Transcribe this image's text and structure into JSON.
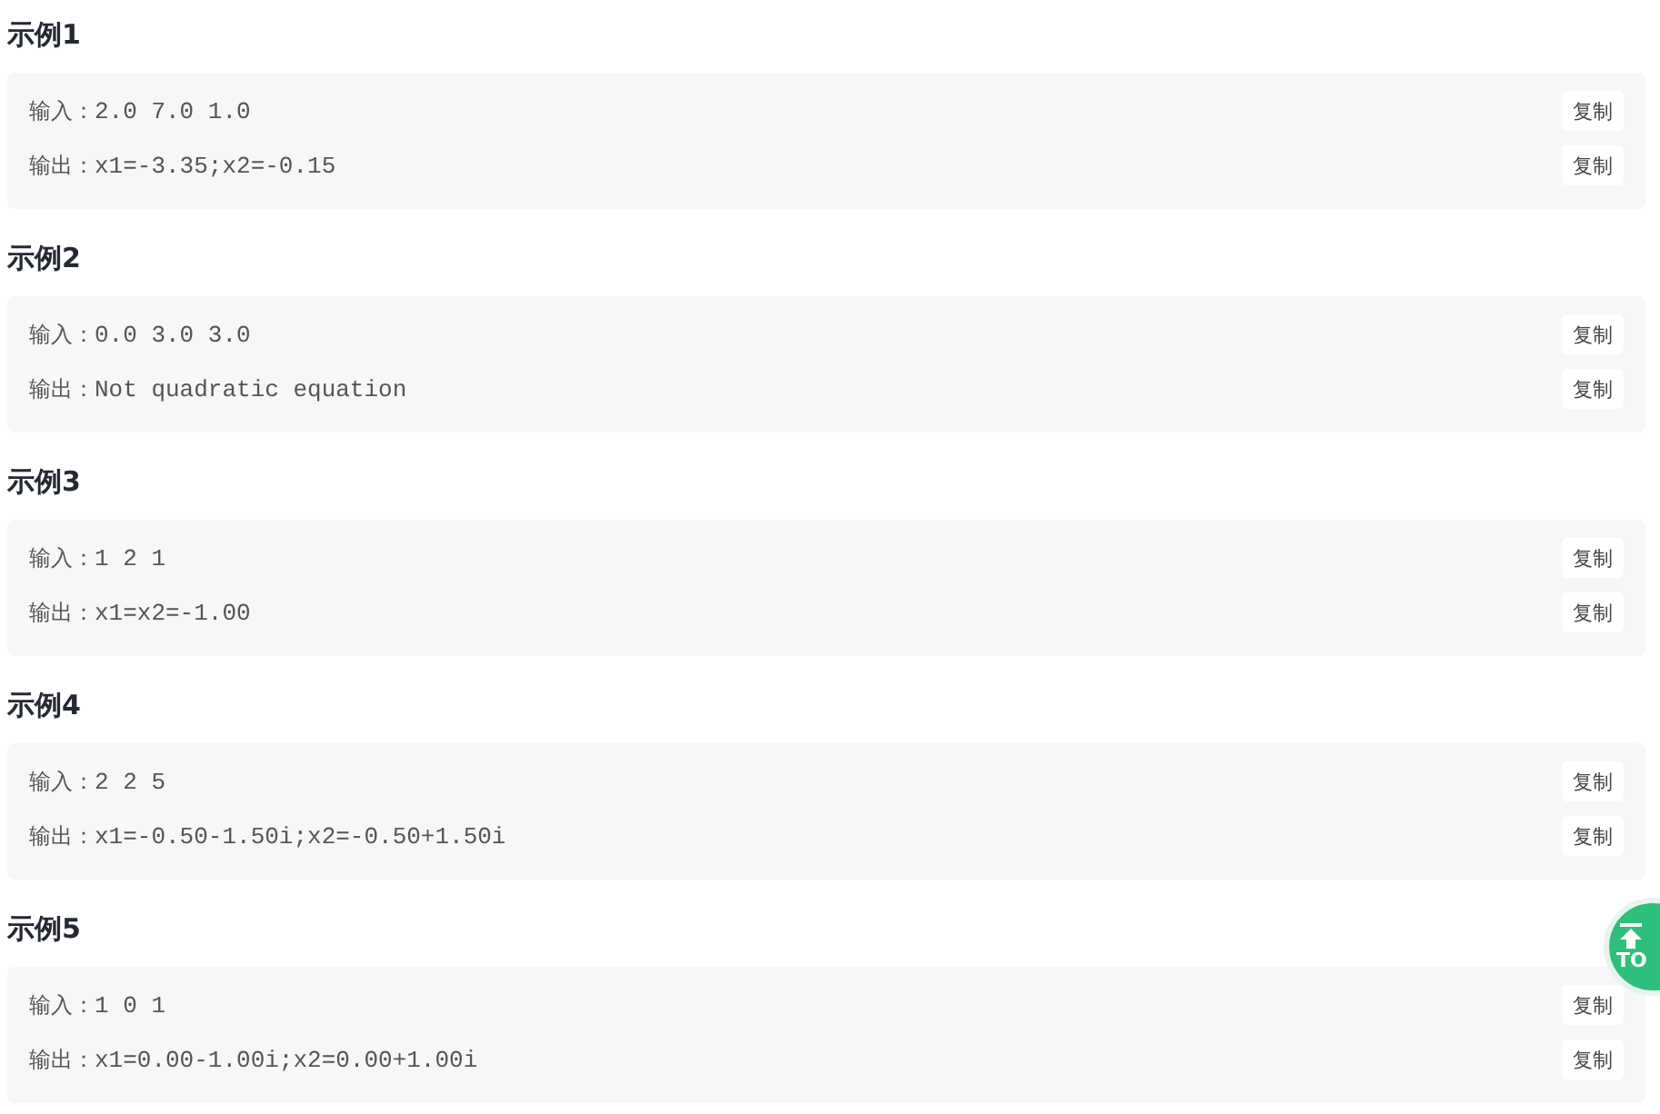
{
  "examples": [
    {
      "title": "示例1",
      "lines": [
        {
          "label": "输入：",
          "value": "2.0 7.0 1.0",
          "button": "复制"
        },
        {
          "label": "输出：",
          "value": "x1=-3.35;x2=-0.15",
          "button": "复制"
        }
      ]
    },
    {
      "title": "示例2",
      "lines": [
        {
          "label": "输入：",
          "value": "0.0 3.0 3.0",
          "button": "复制"
        },
        {
          "label": "输出：",
          "value": "Not quadratic equation",
          "button": "复制"
        }
      ]
    },
    {
      "title": "示例3",
      "lines": [
        {
          "label": "输入：",
          "value": "1 2 1",
          "button": "复制"
        },
        {
          "label": "输出：",
          "value": "x1=x2=-1.00",
          "button": "复制"
        }
      ]
    },
    {
      "title": "示例4",
      "lines": [
        {
          "label": "输入：",
          "value": "2 2 5",
          "button": "复制"
        },
        {
          "label": "输出：",
          "value": "x1=-0.50-1.50i;x2=-0.50+1.50i",
          "button": "复制"
        }
      ]
    },
    {
      "title": "示例5",
      "lines": [
        {
          "label": "输入：",
          "value": "1 0 1",
          "button": "复制"
        },
        {
          "label": "输出：",
          "value": "x1=0.00-1.00i;x2=0.00+1.00i",
          "button": "复制"
        }
      ]
    }
  ],
  "top_button": {
    "label": "TO"
  }
}
